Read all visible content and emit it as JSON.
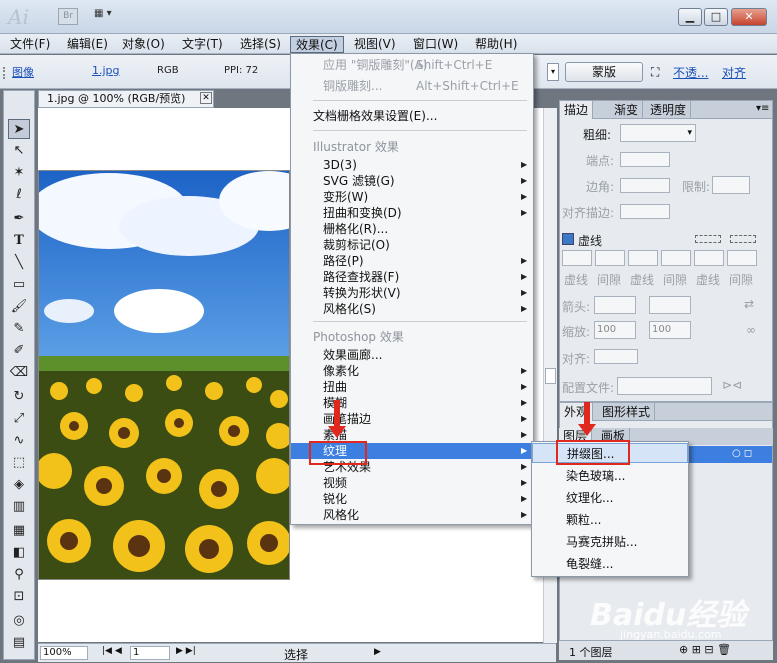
{
  "titlebar": {
    "app_logo": "Ai",
    "bridge": "Br",
    "win_min": "▁",
    "win_max": "□",
    "win_close": "✕"
  },
  "menubar": [
    "文件(F)",
    "编辑(E)",
    "对象(O)",
    "文字(T)",
    "选择(S)",
    "效果(C)",
    "视图(V)",
    "窗口(W)",
    "帮助(H)"
  ],
  "controlbar": {
    "kind": "图像",
    "filename": "1.jpg",
    "color_mode": "RGB",
    "ppi": "PPI: 72",
    "mask_button": "蒙版",
    "opacity_link": "不透...",
    "align_link": "对齐"
  },
  "document": {
    "tab_title": "1.jpg @ 100% (RGB/预览)",
    "zoom": "100%",
    "page": "1",
    "status": "选择"
  },
  "effect_menu": {
    "items_top": [
      {
        "label": "应用 \"铜版雕刻\"(A)",
        "shortcut": "Shift+Ctrl+E",
        "dim": true
      },
      {
        "label": "铜版雕刻...",
        "shortcut": "Alt+Shift+Ctrl+E",
        "dim": true
      },
      {
        "label": "文档栅格效果设置(E)...",
        "shortcut": "",
        "dim": false
      }
    ],
    "illustrator_header": "Illustrator 效果",
    "illustrator_items": [
      {
        "label": "3D(3)",
        "sub": true
      },
      {
        "label": "SVG 滤镜(G)",
        "sub": true
      },
      {
        "label": "变形(W)",
        "sub": true
      },
      {
        "label": "扭曲和变换(D)",
        "sub": true
      },
      {
        "label": "栅格化(R)...",
        "sub": false
      },
      {
        "label": "裁剪标记(O)",
        "sub": false
      },
      {
        "label": "路径(P)",
        "sub": true
      },
      {
        "label": "路径查找器(F)",
        "sub": true
      },
      {
        "label": "转换为形状(V)",
        "sub": true
      },
      {
        "label": "风格化(S)",
        "sub": true
      }
    ],
    "photoshop_header": "Photoshop 效果",
    "photoshop_items": [
      {
        "label": "效果画廊...",
        "sub": false
      },
      {
        "label": "像素化",
        "sub": true
      },
      {
        "label": "扭曲",
        "sub": true
      },
      {
        "label": "模糊",
        "sub": true
      },
      {
        "label": "画笔描边",
        "sub": true
      },
      {
        "label": "素描",
        "sub": true
      },
      {
        "label": "纹理",
        "sub": true
      },
      {
        "label": "艺术效果",
        "sub": true
      },
      {
        "label": "视频",
        "sub": true
      },
      {
        "label": "锐化",
        "sub": true
      },
      {
        "label": "风格化",
        "sub": true
      }
    ]
  },
  "texture_submenu": [
    "拼缀图...",
    "染色玻璃...",
    "纹理化...",
    "颗粒...",
    "马赛克拼贴...",
    "龟裂缝..."
  ],
  "stroke_panel": {
    "tabs": [
      "描边",
      "渐变",
      "透明度"
    ],
    "weight": "粗细:",
    "cap": "端点:",
    "corner": "边角:",
    "limit": "限制:",
    "align_stroke": "对齐描边:",
    "dashed": "虚线",
    "dash_labels": [
      "虚线",
      "间隙",
      "虚线",
      "间隙",
      "虚线",
      "间隙"
    ],
    "arrowheads": "箭头:",
    "scale": "缩放:",
    "scale_start": "100",
    "scale_end": "100",
    "align": "对齐:",
    "profile": "配置文件:"
  },
  "appearance_panel": {
    "tabs": [
      "外观",
      "图形样式"
    ],
    "layer_tabs": [
      "图层",
      "画板"
    ]
  },
  "layers_status": {
    "count": "1 个图层"
  },
  "watermark": {
    "main": "Baidu经验",
    "sub": "jingyan.baidu.com"
  }
}
